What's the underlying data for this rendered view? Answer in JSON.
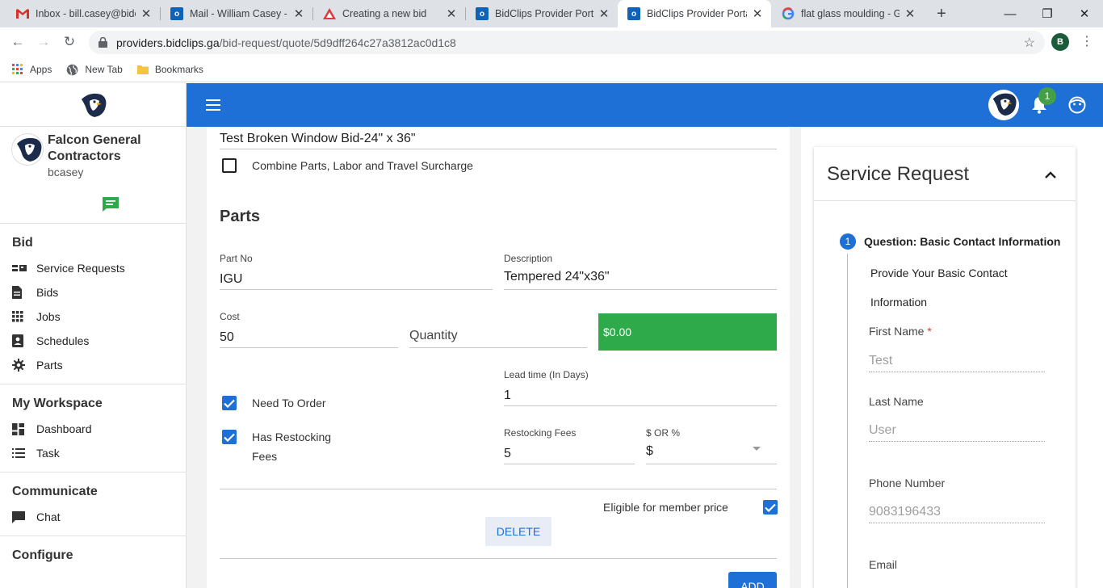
{
  "browser": {
    "tabs": [
      {
        "title": "Inbox - bill.casey@bidclips",
        "icon": "gmail-icon",
        "active": false
      },
      {
        "title": "Mail - William Casey - Outlook",
        "icon": "outlook-icon",
        "active": false
      },
      {
        "title": "Creating a new bid",
        "icon": "creating-bid-icon",
        "active": false
      },
      {
        "title": "BidClips Provider Portal",
        "icon": "outlook-icon",
        "active": false
      },
      {
        "title": "BidClips Provider Portal",
        "icon": "outlook-icon",
        "active": true
      },
      {
        "title": "flat glass moulding - Google Search",
        "icon": "google-icon",
        "active": false
      }
    ],
    "url_host": "providers.bidclips.ga",
    "url_path": "/bid-request/quote/5d9dff264c27a3812ac0d1c8",
    "profile_initial": "B",
    "bookmarks": [
      "Apps",
      "New Tab",
      "Bookmarks"
    ]
  },
  "sidebar": {
    "company": "Falcon General Contractors",
    "username": "bcasey",
    "sections": [
      {
        "heading": "Bid",
        "items": [
          {
            "label": "Service Requests",
            "icon": "id-card-icon"
          },
          {
            "label": "Bids",
            "icon": "document-icon"
          },
          {
            "label": "Jobs",
            "icon": "grid-icon"
          },
          {
            "label": "Schedules",
            "icon": "contact-card-icon"
          },
          {
            "label": "Parts",
            "icon": "gear-icon"
          }
        ]
      },
      {
        "heading": "My Workspace",
        "items": [
          {
            "label": "Dashboard",
            "icon": "dashboard-icon"
          },
          {
            "label": "Task",
            "icon": "list-icon"
          }
        ]
      },
      {
        "heading": "Communicate",
        "items": [
          {
            "label": "Chat",
            "icon": "chat-icon"
          }
        ]
      },
      {
        "heading": "Configure",
        "items": []
      }
    ]
  },
  "appbar": {
    "notification_count": "1"
  },
  "bid_form": {
    "bid_title": "Test Broken Window Bid-24\" x 36\"",
    "combine_label": "Combine Parts, Labor and Travel Surcharge",
    "combine_checked": false,
    "parts_heading": "Parts",
    "part_no_label": "Part No",
    "part_no_value": "IGU",
    "description_label": "Description",
    "description_value": "Tempered 24\"x36\"",
    "cost_label": "Cost",
    "cost_value": "50",
    "quantity_placeholder": "Quantity",
    "total": "$0.00",
    "need_to_order_label": "Need To Order",
    "need_to_order_checked": true,
    "lead_time_label": "Lead time (In Days)",
    "lead_time_value": "1",
    "has_restocking_label_1": "Has Restocking",
    "has_restocking_label_2": "Fees",
    "has_restocking_checked": true,
    "restocking_fees_label": "Restocking Fees",
    "restocking_fees_value": "5",
    "dollar_or_percent_label": "$ OR %",
    "dollar_or_percent_value": "$",
    "eligible_label": "Eligible for member price",
    "eligible_checked": true,
    "delete_label": "DELETE",
    "add_label": "ADD"
  },
  "service_request": {
    "title": "Service Request",
    "step_number": "1",
    "step_title": "Question: Basic Contact Information",
    "desc_line1": "Provide Your Basic Contact",
    "desc_line2": "Information",
    "first_name_label": "First Name",
    "required_mark": "*",
    "first_name_value": "Test",
    "last_name_label": "Last Name",
    "last_name_value": "User",
    "phone_label": "Phone Number",
    "phone_value": "9083196433",
    "email_label": "Email"
  },
  "colors": {
    "primary": "#1e6fd6",
    "total_green": "#2eaa4a",
    "badge_green": "#43a047",
    "chat_icon_green": "#2eaa4a"
  }
}
